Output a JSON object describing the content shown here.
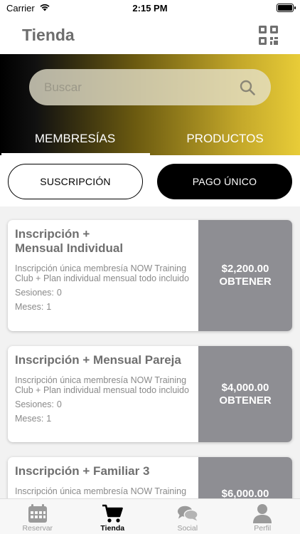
{
  "status_bar": {
    "carrier": "Carrier",
    "time": "2:15 PM"
  },
  "header": {
    "title": "Tienda"
  },
  "search": {
    "placeholder": "Buscar"
  },
  "tabs": [
    {
      "label": "MEMBRESÍAS",
      "active": true
    },
    {
      "label": "PRODUCTOS",
      "active": false
    }
  ],
  "segments": {
    "subscription": "SUSCRIPCIÓN",
    "single_payment": "PAGO ÚNICO",
    "selected": "single_payment"
  },
  "cards": [
    {
      "title": "Inscripción +\nMensual Individual",
      "description": "Inscripción única membresía NOW Training Club + Plan individual mensual todo incluido",
      "sessions_label": "Sesiones:",
      "sessions": "0",
      "months_label": "Meses:",
      "months": "1",
      "price": "$2,200.00",
      "action": "OBTENER"
    },
    {
      "title": "Inscripción + Mensual Pareja",
      "description": "Inscripción única membresía NOW Training Club + Plan individual mensual todo incluido",
      "sessions_label": "Sesiones:",
      "sessions": "0",
      "months_label": "Meses:",
      "months": "1",
      "price": "$4,000.00",
      "action": "OBTENER"
    },
    {
      "title": "Inscripción + Familiar 3",
      "description": "Inscripción única membresía NOW Training",
      "price": "$6,000.00"
    }
  ],
  "tab_bar": [
    {
      "label": "Reservar",
      "icon": "calendar-icon",
      "active": false
    },
    {
      "label": "Tienda",
      "icon": "cart-icon",
      "active": true
    },
    {
      "label": "Social",
      "icon": "chat-bubbles-icon",
      "active": false
    },
    {
      "label": "Perfil",
      "icon": "person-icon",
      "active": false
    }
  ],
  "colors": {
    "accent_gold": "#e8cc38",
    "price_panel": "#8e8e93",
    "title_gray": "#6f6f6f"
  }
}
